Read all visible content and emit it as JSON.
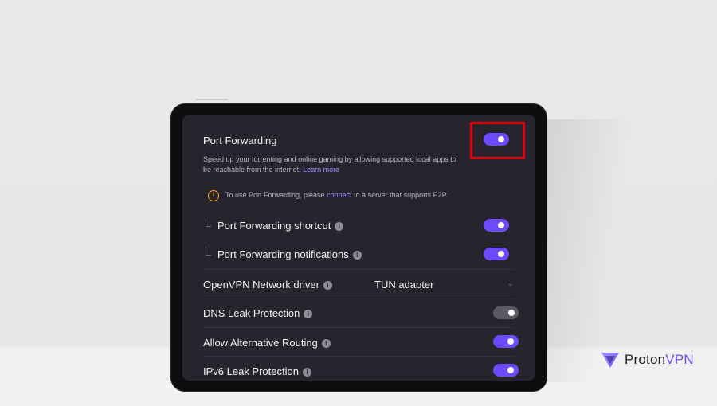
{
  "port_forwarding": {
    "title": "Port Forwarding",
    "toggle_on": true,
    "description": "Speed up your torrenting and online gaming by allowing supported local apps to be reachable from the internet.",
    "learn_more": "Learn more"
  },
  "warning": {
    "prefix": "To use Port Forwarding, please ",
    "link": "connect",
    "suffix": " to a server that supports P2P."
  },
  "sub_settings": [
    {
      "label": "Port Forwarding shortcut",
      "toggle_on": true
    },
    {
      "label": "Port Forwarding notifications",
      "toggle_on": true
    }
  ],
  "openvpn_driver": {
    "label": "OpenVPN Network driver",
    "value": "TUN adapter"
  },
  "settings": [
    {
      "label": "DNS Leak Protection",
      "toggle_on": false
    },
    {
      "label": "Allow Alternative Routing",
      "toggle_on": true
    },
    {
      "label": "IPv6 Leak Protection",
      "toggle_on": true
    }
  ],
  "brand": {
    "name_a": "Proton",
    "name_b": "VPN"
  },
  "colors": {
    "accent": "#6d4aff",
    "highlight": "#e3000b",
    "warning": "#f0a41f",
    "panel": "#26242d"
  }
}
